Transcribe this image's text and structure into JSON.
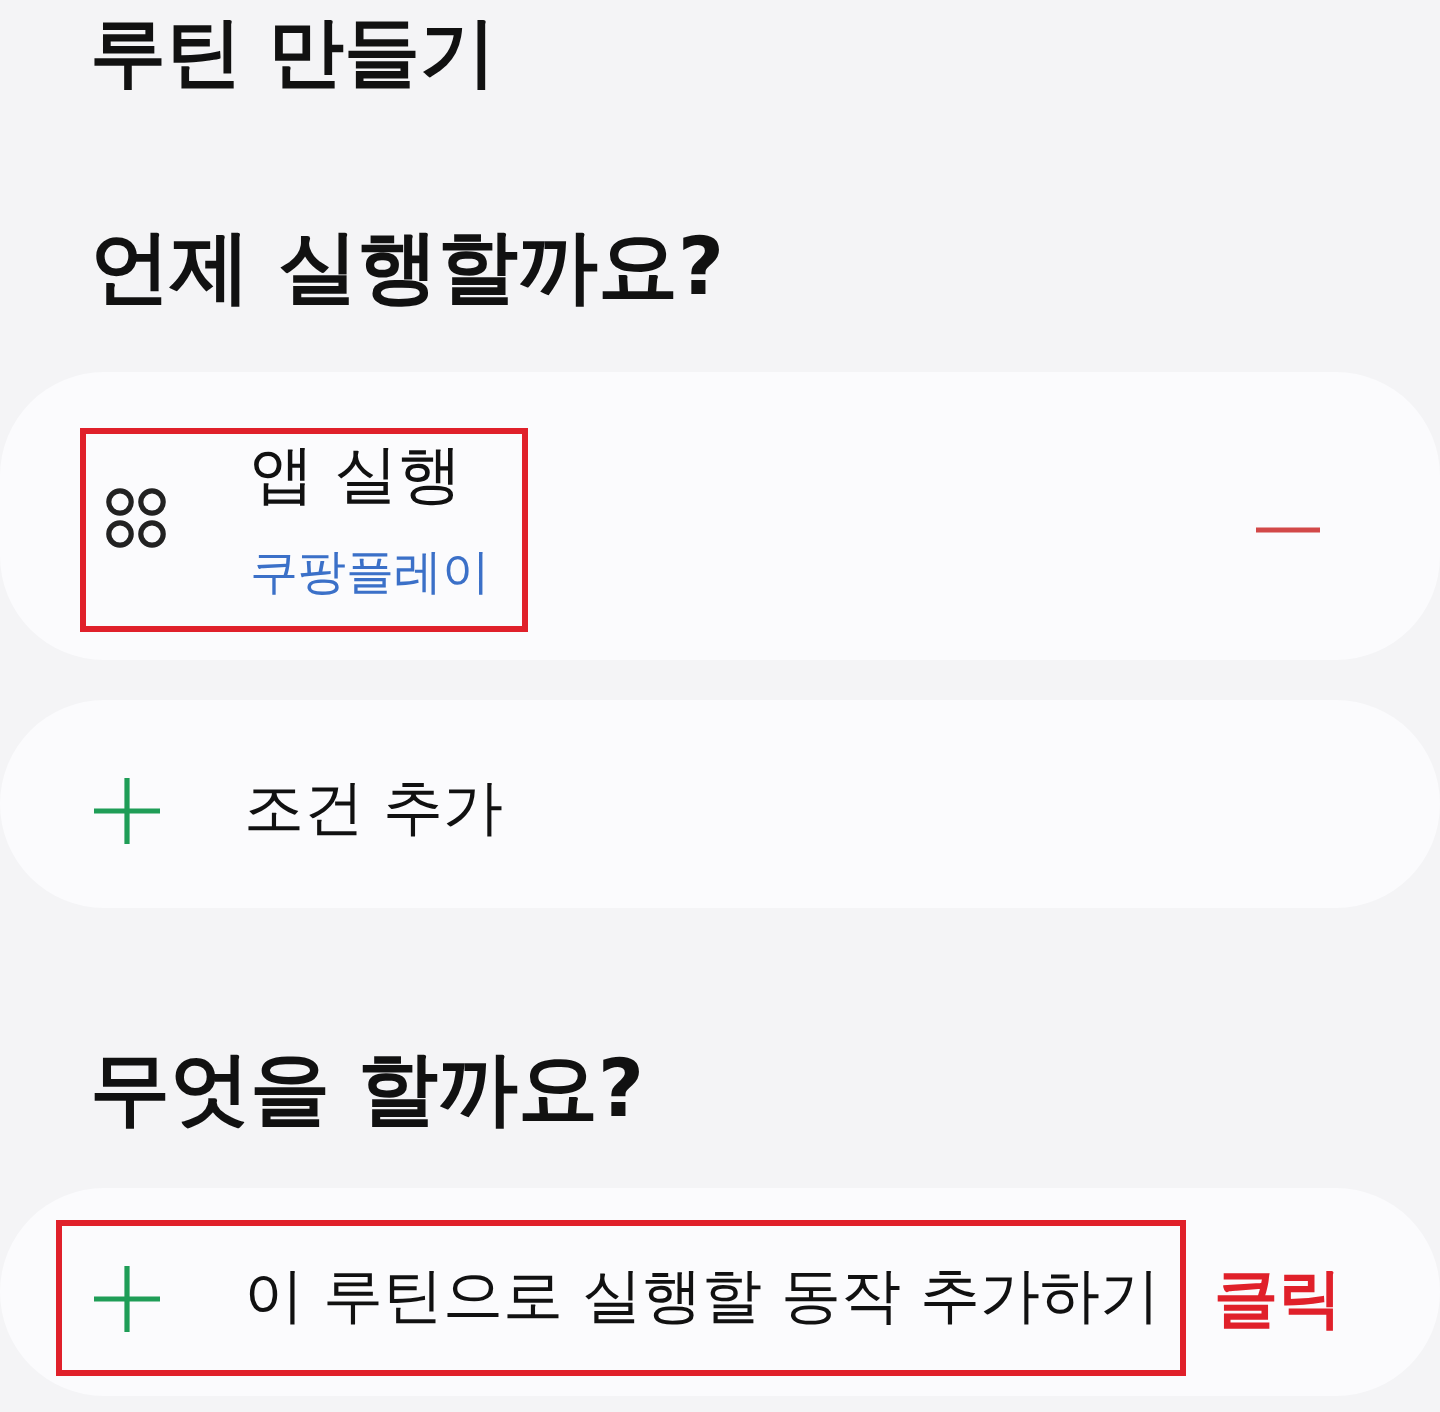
{
  "screen_title": "루틴 만들기",
  "sections": [
    {
      "heading": "언제 실행할까요?",
      "items": [
        {
          "kind": "condition",
          "title": "앱 실행",
          "subtitle": "쿠팡플레이",
          "removable": true,
          "highlighted": true
        },
        {
          "kind": "add",
          "label": "조건 추가",
          "highlighted": false
        }
      ]
    },
    {
      "heading": "무엇을 할까요?",
      "items": [
        {
          "kind": "add",
          "label": "이 루틴으로 실행할 동작 추가하기",
          "highlighted": true,
          "callout": "클릭"
        }
      ]
    }
  ]
}
